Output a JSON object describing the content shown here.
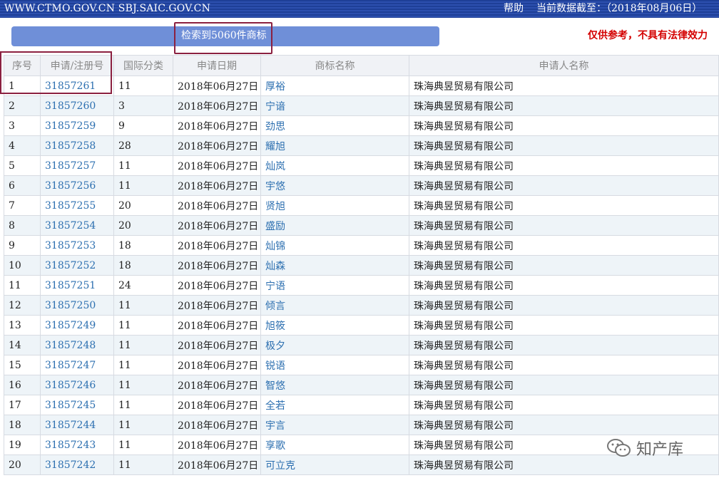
{
  "header": {
    "site": "WWW.CTMO.GOV.CN SBJ.SAIC.GOV.CN",
    "help": "帮助",
    "data_as_of": "当前数据截至：（2018年08月06日）"
  },
  "search": {
    "result_count_text": "检索到5060件商标",
    "disclaimer": "仅供参考，不具有法律效力"
  },
  "table": {
    "columns": [
      "序号",
      "申请/注册号",
      "国际分类",
      "申请日期",
      "商标名称",
      "申请人名称"
    ],
    "rows": [
      {
        "no": "1",
        "reg": "31857261",
        "cls": "11",
        "date": "2018年06月27日",
        "mark": "厚裕",
        "applicant": "珠海典昱贸易有限公司"
      },
      {
        "no": "2",
        "reg": "31857260",
        "cls": "3",
        "date": "2018年06月27日",
        "mark": "宁谙",
        "applicant": "珠海典昱贸易有限公司"
      },
      {
        "no": "3",
        "reg": "31857259",
        "cls": "9",
        "date": "2018年06月27日",
        "mark": "劲思",
        "applicant": "珠海典昱贸易有限公司"
      },
      {
        "no": "4",
        "reg": "31857258",
        "cls": "28",
        "date": "2018年06月27日",
        "mark": "耀旭",
        "applicant": "珠海典昱贸易有限公司"
      },
      {
        "no": "5",
        "reg": "31857257",
        "cls": "11",
        "date": "2018年06月27日",
        "mark": "灿岚",
        "applicant": "珠海典昱贸易有限公司"
      },
      {
        "no": "6",
        "reg": "31857256",
        "cls": "11",
        "date": "2018年06月27日",
        "mark": "宇悠",
        "applicant": "珠海典昱贸易有限公司"
      },
      {
        "no": "7",
        "reg": "31857255",
        "cls": "20",
        "date": "2018年06月27日",
        "mark": "贤旭",
        "applicant": "珠海典昱贸易有限公司"
      },
      {
        "no": "8",
        "reg": "31857254",
        "cls": "20",
        "date": "2018年06月27日",
        "mark": "盛励",
        "applicant": "珠海典昱贸易有限公司"
      },
      {
        "no": "9",
        "reg": "31857253",
        "cls": "18",
        "date": "2018年06月27日",
        "mark": "灿锦",
        "applicant": "珠海典昱贸易有限公司"
      },
      {
        "no": "10",
        "reg": "31857252",
        "cls": "18",
        "date": "2018年06月27日",
        "mark": "灿森",
        "applicant": "珠海典昱贸易有限公司"
      },
      {
        "no": "11",
        "reg": "31857251",
        "cls": "24",
        "date": "2018年06月27日",
        "mark": "宁语",
        "applicant": "珠海典昱贸易有限公司"
      },
      {
        "no": "12",
        "reg": "31857250",
        "cls": "11",
        "date": "2018年06月27日",
        "mark": "倾言",
        "applicant": "珠海典昱贸易有限公司"
      },
      {
        "no": "13",
        "reg": "31857249",
        "cls": "11",
        "date": "2018年06月27日",
        "mark": "旭筱",
        "applicant": "珠海典昱贸易有限公司"
      },
      {
        "no": "14",
        "reg": "31857248",
        "cls": "11",
        "date": "2018年06月27日",
        "mark": "极夕",
        "applicant": "珠海典昱贸易有限公司"
      },
      {
        "no": "15",
        "reg": "31857247",
        "cls": "11",
        "date": "2018年06月27日",
        "mark": "锐语",
        "applicant": "珠海典昱贸易有限公司"
      },
      {
        "no": "16",
        "reg": "31857246",
        "cls": "11",
        "date": "2018年06月27日",
        "mark": "智悠",
        "applicant": "珠海典昱贸易有限公司"
      },
      {
        "no": "17",
        "reg": "31857245",
        "cls": "11",
        "date": "2018年06月27日",
        "mark": "全若",
        "applicant": "珠海典昱贸易有限公司"
      },
      {
        "no": "18",
        "reg": "31857244",
        "cls": "11",
        "date": "2018年06月27日",
        "mark": "宇言",
        "applicant": "珠海典昱贸易有限公司"
      },
      {
        "no": "19",
        "reg": "31857243",
        "cls": "11",
        "date": "2018年06月27日",
        "mark": "享歌",
        "applicant": "珠海典昱贸易有限公司"
      },
      {
        "no": "20",
        "reg": "31857242",
        "cls": "11",
        "date": "2018年06月27日",
        "mark": "可立克",
        "applicant": "珠海典昱贸易有限公司"
      }
    ]
  },
  "watermark": {
    "text": "知产库",
    "icon": "wechat-icon"
  },
  "colors": {
    "header_bg": "#1e3f97",
    "search_bar": "#6f8fd8",
    "link": "#2c6fb0",
    "disclaimer": "#d40000",
    "highlight_box": "#8b2040"
  }
}
